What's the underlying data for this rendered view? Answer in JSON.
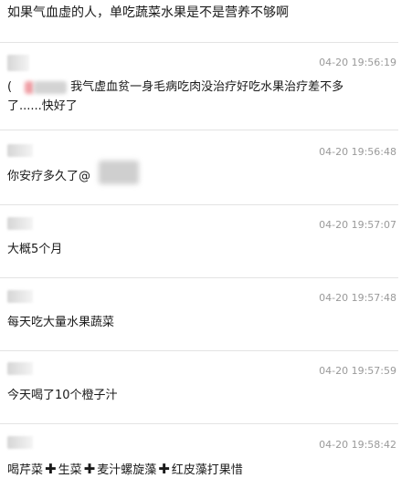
{
  "top_comment": "如果气血虚的人，单吃蔬菜水果是不是营养不够啊",
  "replies": [
    {
      "timestamp": "04-20 19:56:19",
      "line1": "我气虚血贫一身毛病吃肉没治疗好吃水果治疗差不多",
      "line1_prefix": "(",
      "line2": "了......快好了"
    },
    {
      "timestamp": "04-20 19:56:48",
      "text": "你安疗多久了@"
    },
    {
      "timestamp": "04-20 19:57:07",
      "text": "大概5个月"
    },
    {
      "timestamp": "04-20 19:57:48",
      "text": "每天吃大量水果蔬菜"
    },
    {
      "timestamp": "04-20 19:57:59",
      "text": "今天喝了10个橙子汁"
    },
    {
      "timestamp": "04-20 19:58:42",
      "parts": [
        "喝芹菜",
        "生菜",
        "麦汁螺旋藻",
        "红皮藻打果惜"
      ],
      "plus_glyph": "✚"
    }
  ]
}
